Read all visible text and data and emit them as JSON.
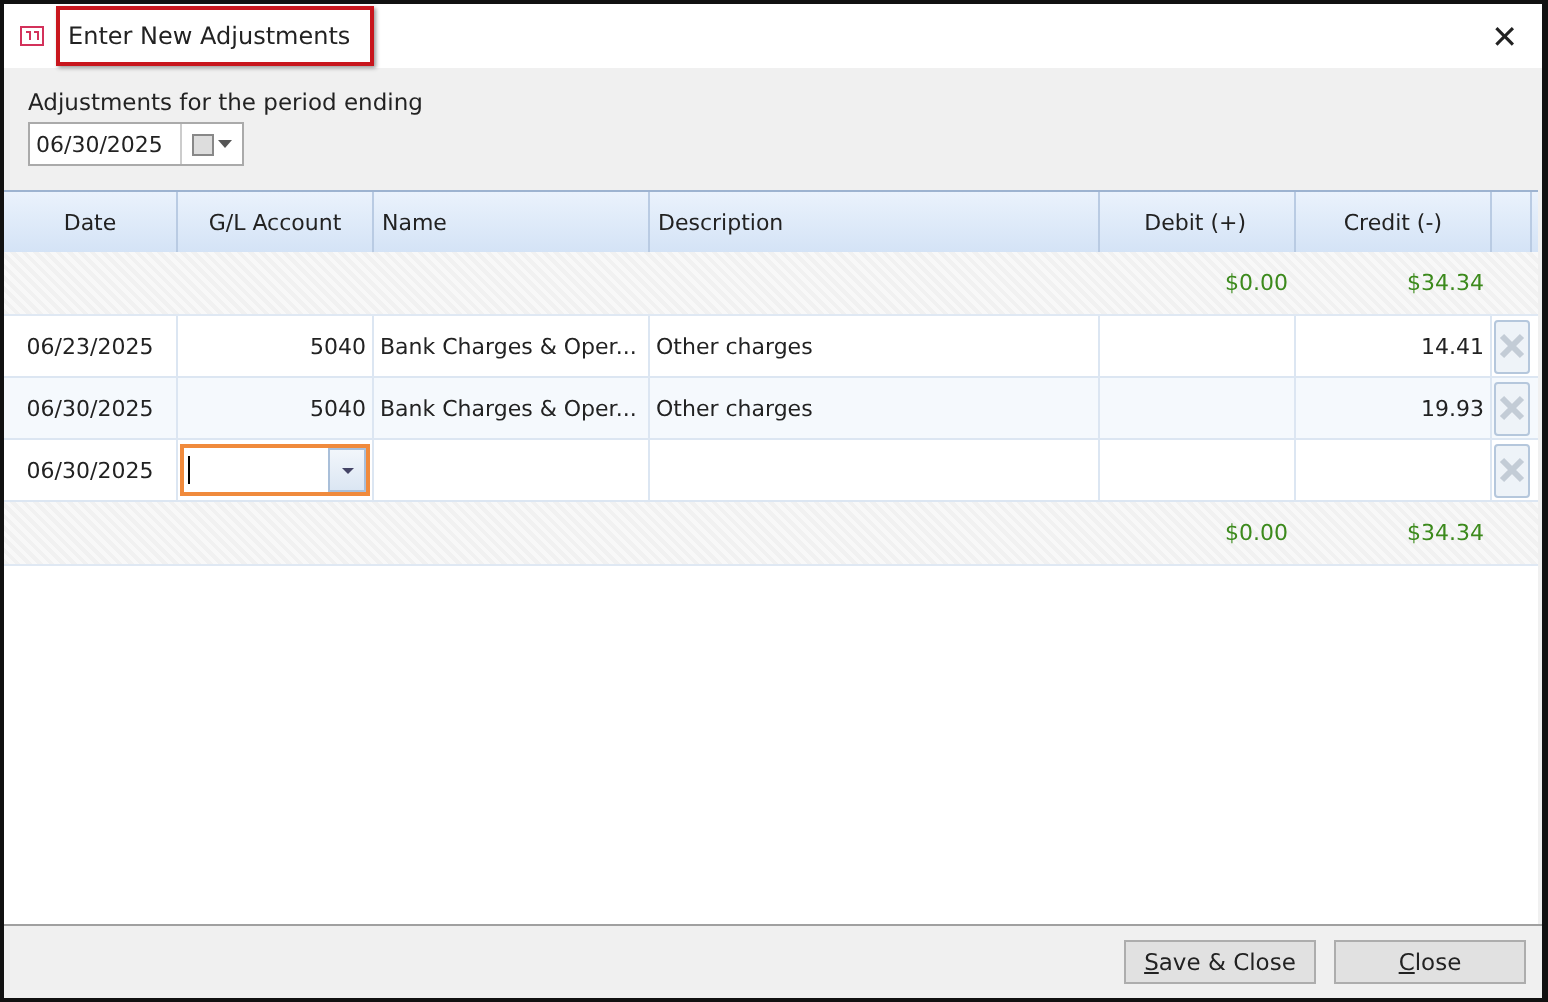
{
  "window": {
    "title": "Enter New Adjustments",
    "highlighted": true,
    "close_glyph": "✕"
  },
  "period": {
    "label": "Adjustments for the period ending",
    "value": "06/30/2025"
  },
  "table": {
    "columns": [
      "Date",
      "G/L Account",
      "Name",
      "Description",
      "Debit (+)",
      "Credit (-)"
    ],
    "top_totals": {
      "debit": "$0.00",
      "credit": "$34.34"
    },
    "rows": [
      {
        "date": "06/23/2025",
        "gl_account": "5040",
        "name": "Bank Charges & Oper...",
        "description": "Other charges",
        "credit": "14.41",
        "editing": false
      },
      {
        "date": "06/30/2025",
        "gl_account": "5040",
        "name": "Bank Charges & Oper...",
        "description": "Other charges",
        "credit": "19.93",
        "editing": false
      },
      {
        "date": "06/30/2025",
        "editing": true
      }
    ],
    "bottom_totals": {
      "debit": "$0.00",
      "credit": "$34.34"
    }
  },
  "buttons": [
    {
      "label": "Save & Close",
      "mnemonic": true
    },
    {
      "label": "Close",
      "mnemonic": true
    }
  ]
}
